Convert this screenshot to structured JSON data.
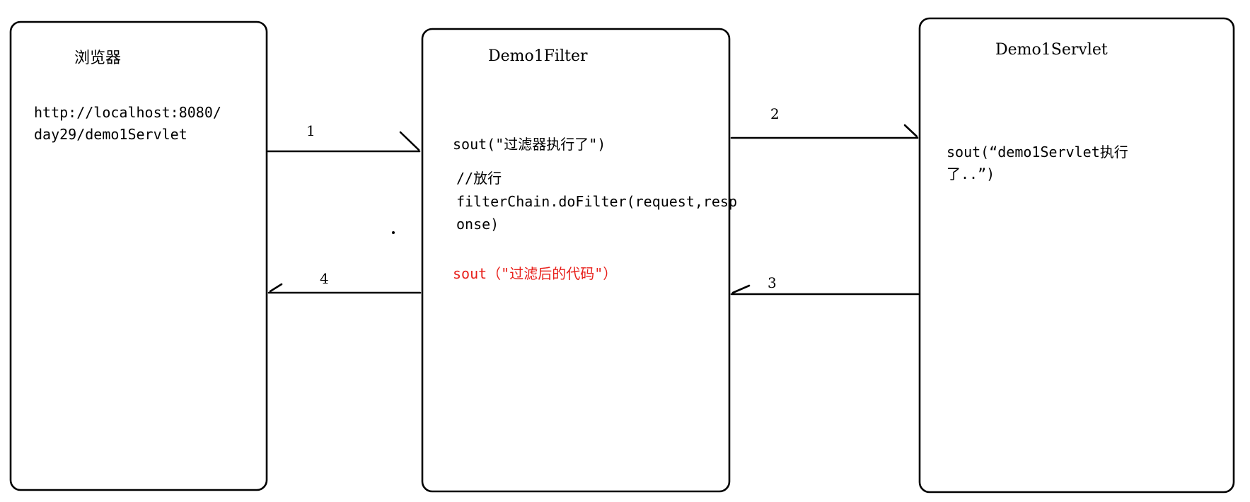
{
  "colors": {
    "stroke": "#000000",
    "background": "#ffffff",
    "highlight_text": "#e8211c"
  },
  "browser": {
    "title": "浏览器",
    "url_line1": "http://localhost:8080/",
    "url_line2": "day29/demo1Servlet"
  },
  "filter": {
    "title": "Demo1Filter",
    "code_line1": "sout(\"过滤器执行了\")",
    "code_line2": "//放行",
    "code_line3": "filterChain.doFilter(request,resp",
    "code_line4": "onse)",
    "code_line5": "sout（\"过滤后的代码\"）"
  },
  "servlet": {
    "title": "Demo1Servlet",
    "code_line1": "sout(“demo1Servlet执行",
    "code_line2": "了..”)"
  },
  "arrows": {
    "step1": "1",
    "step2": "2",
    "step3": "3",
    "step4": "4"
  }
}
